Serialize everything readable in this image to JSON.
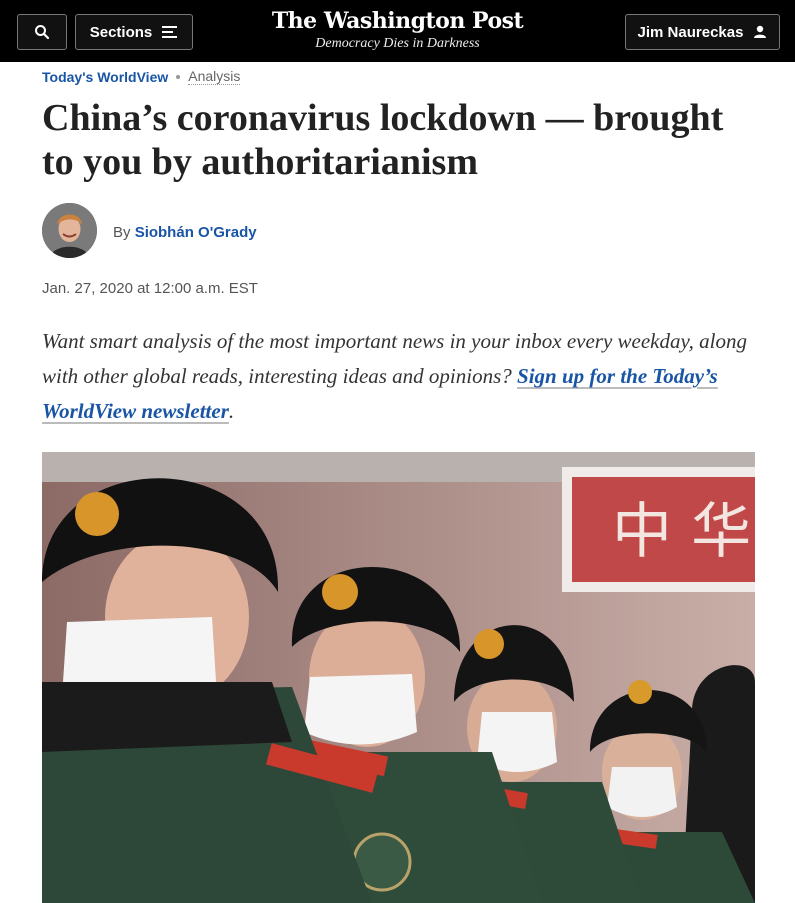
{
  "header": {
    "sections_label": "Sections",
    "brand_title": "The Washington Post",
    "brand_tagline": "Democracy Dies in Darkness",
    "user_label": "Jim Naureckas",
    "search_icon": "search-icon",
    "menu_icon": "hamburger-icon",
    "user_icon": "user-icon"
  },
  "kicker": {
    "section": "Today's WorldView",
    "label": "Analysis"
  },
  "article": {
    "headline": "China’s coronavirus lockdown — brought to you by authoritarianism",
    "byline_prefix": "By",
    "author": "Siobhán O'Grady",
    "date": "Jan. 27, 2020 at 12:00 a.m. EST",
    "promo_text": "Want smart analysis of the most important news in your inbox every weekday, along with other global reads, interesting ideas and opinions?",
    "promo_link": "Sign up for the Today’s WorldView newsletter",
    "promo_end": ".",
    "photo_sign_text": "中 华"
  },
  "colors": {
    "link": "#1955a5",
    "topbar": "#000000"
  }
}
